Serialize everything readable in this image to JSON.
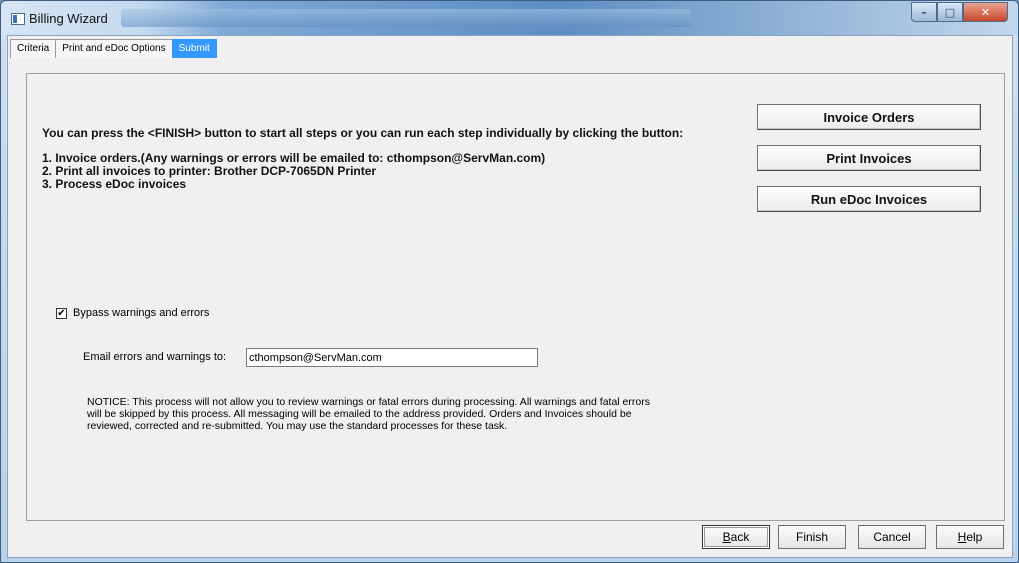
{
  "window": {
    "title": "Billing Wizard"
  },
  "tabs": [
    {
      "label": "Criteria",
      "active": false
    },
    {
      "label": "Print and eDoc Options",
      "active": false
    },
    {
      "label": "Submit",
      "active": true
    }
  ],
  "main": {
    "intro": "You can press the <FINISH> button to start all steps or you can run each step individually by clicking the button:",
    "steps": [
      "1. Invoice orders.(Any warnings or errors will be emailed to: cthompson@ServMan.com)",
      "2. Print all invoices to printer: Brother DCP-7065DN Printer",
      "3. Process eDoc invoices"
    ],
    "buttons": {
      "invoice_orders": "Invoice Orders",
      "print_invoices": "Print Invoices",
      "run_edoc": "Run eDoc Invoices"
    },
    "bypass": {
      "label": "Bypass warnings and errors",
      "checked": true,
      "check_mark": "✔"
    },
    "email": {
      "label": "Email errors and warnings to:",
      "value": "cthompson@ServMan.com"
    },
    "notice": [
      "NOTICE: This process will not allow you to review warnings or fatal errors during processing.  All warnings and fatal errors",
      "will be skipped by this process. All messaging will be emailed to the address provided. Orders and Invoices should be",
      "reviewed, corrected and re-submitted. You may use the standard processes for these task."
    ]
  },
  "footer": {
    "back": {
      "accel": "B",
      "rest": "ack"
    },
    "finish": "Finish",
    "cancel": "Cancel",
    "help": {
      "accel": "H",
      "rest": "elp"
    }
  },
  "colors": {
    "active_tab": "#3399ff",
    "window_frame": "#6e93b8",
    "close_button": "#c8472c"
  }
}
